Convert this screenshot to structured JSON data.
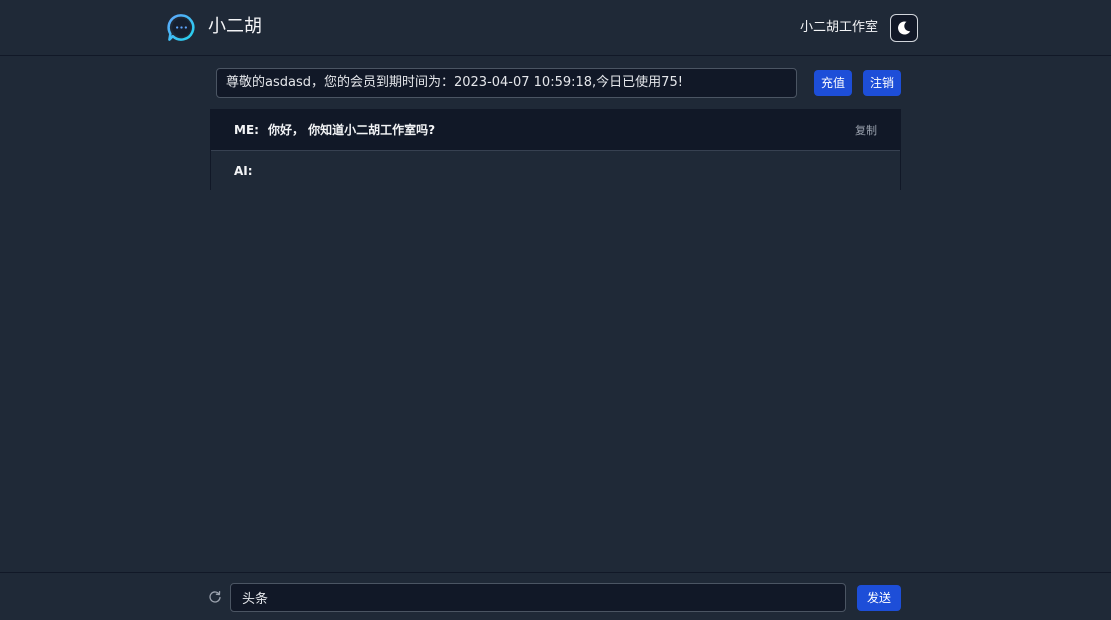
{
  "header": {
    "brand": "小二胡",
    "studio_link": "小二胡工作室",
    "theme_icon": "moon-icon"
  },
  "notice": {
    "text": "尊敬的asdasd，您的会员到期时间为：2023-04-07 10:59:18,今日已使用75!"
  },
  "actions": {
    "recharge_label": "充值",
    "logout_label": "注销"
  },
  "chat": {
    "messages": [
      {
        "role": "ME:",
        "text": "你好， 你知道小二胡工作室吗?",
        "copy_label": "复制"
      },
      {
        "role": "AI:",
        "text": ""
      }
    ]
  },
  "composer": {
    "input_value": "头条",
    "send_label": "发送",
    "refresh_icon": "refresh-icon"
  },
  "colors": {
    "background": "#1f2937",
    "panel": "#111827",
    "accent": "#1d4ed8"
  }
}
